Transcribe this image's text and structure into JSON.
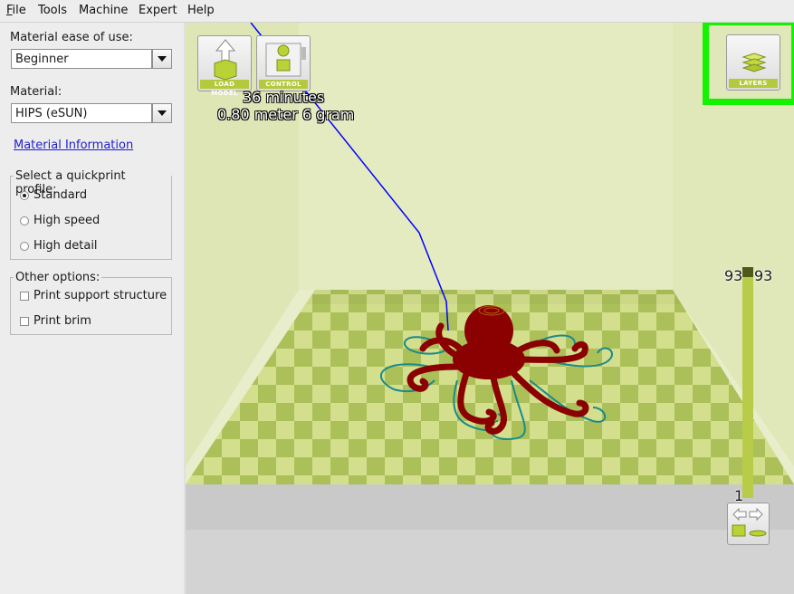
{
  "menu": {
    "items": [
      {
        "key": "file",
        "label": "File",
        "mnemonic": "F",
        "rest": "ile"
      },
      {
        "key": "tools",
        "label": "Tools"
      },
      {
        "key": "machine",
        "label": "Machine"
      },
      {
        "key": "expert",
        "label": "Expert"
      },
      {
        "key": "help",
        "label": "Help"
      }
    ]
  },
  "left_panel": {
    "ease_label": "Material ease of use:",
    "ease_value": "Beginner",
    "material_label": "Material:",
    "material_value": "HIPS (eSUN)",
    "material_info_link": "Material Information",
    "quickprint": {
      "title": "Select a quickprint profile:",
      "options": [
        "Standard",
        "High speed",
        "High detail"
      ],
      "selected": "Standard"
    },
    "other": {
      "title": "Other options:",
      "options": [
        "Print support structure",
        "Print brim"
      ]
    }
  },
  "viewport": {
    "load_model_caption": "LOAD MODEL",
    "control_caption": "CONTROL",
    "layers_caption": "LAYERS",
    "print_time": "36 minutes",
    "print_material": "0.80 meter 6 gram",
    "layer_top_left": "93",
    "layer_top_right": "93",
    "layer_bottom": "1",
    "colors": {
      "bed_light": "#d4e08f",
      "bed_dark": "#a8bd55",
      "model": "#8b0000",
      "outline": "#1a8a8a",
      "highlight": "#13f300",
      "path": "#0000ff"
    }
  }
}
